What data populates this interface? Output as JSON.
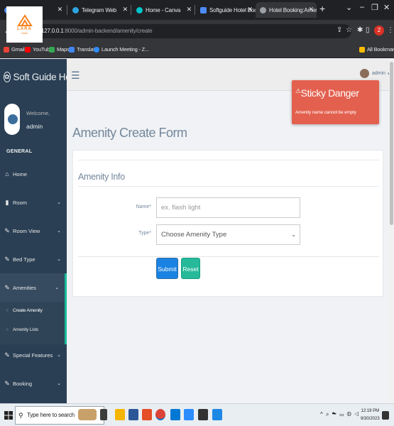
{
  "browser": {
    "tabs": [
      {
        "label": "",
        "color": "#4c8bf5"
      },
      {
        "label": "Telegram Web",
        "color": "#2ca5e0"
      },
      {
        "label": "Home - Canva",
        "color": "#00c4cc"
      },
      {
        "label": "Softguide Hotel Booking - F",
        "color": "#4c8bf5"
      },
      {
        "label": "Hotel Booking:Amenity Cre",
        "color": "#9aa0a6"
      }
    ],
    "url_host": "127.0.0.1",
    "url_path": ":8000/admin-backend/amenity/create",
    "bookmarks": [
      "Gmail",
      "YouTube",
      "Maps",
      "Translate",
      "Launch Meeting - Z..."
    ],
    "all_bookmarks": "All Bookmarks",
    "profile_letter": "2"
  },
  "logo": {
    "name": "LARA",
    "tagline": "Hotel"
  },
  "sidebar": {
    "brand": "Soft Guide Hotel",
    "welcome": "Welcome,",
    "username": "admin",
    "section": "GENERAL",
    "items": [
      {
        "label": "Home",
        "icon": "home-icon"
      },
      {
        "label": "Room",
        "icon": "room-icon"
      },
      {
        "label": "Room View",
        "icon": "edit-icon"
      },
      {
        "label": "Bed Type",
        "icon": "edit-icon"
      },
      {
        "label": "Amenities",
        "icon": "edit-icon"
      },
      {
        "label": "Special Features",
        "icon": "edit-icon"
      },
      {
        "label": "Booking",
        "icon": "edit-icon"
      }
    ],
    "submenu": [
      "Create Amenity",
      "Amenity Lists"
    ]
  },
  "topnav": {
    "user": "admin"
  },
  "page": {
    "title": "Amenity Create Form",
    "panel_title": "Amenity Info",
    "name_label": "Name*",
    "name_placeholder": "ex. flash light",
    "type_label": "Type*",
    "type_value": "Choose Amenity Type",
    "submit": "Submit",
    "reset": "Reset"
  },
  "toast": {
    "title": "Sticky Danger",
    "message": "Amenity name cannot be empty",
    "color": "#e3604f"
  },
  "taskbar": {
    "search_placeholder": "Type here to search",
    "time": "12:19 PM",
    "date": "9/30/2023"
  }
}
